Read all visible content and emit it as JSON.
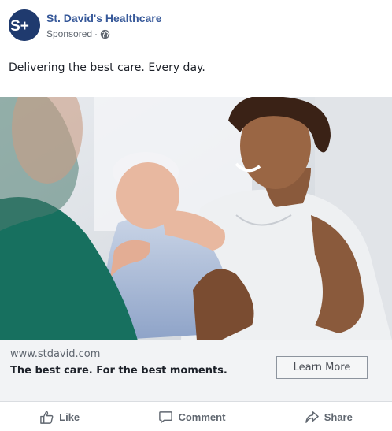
{
  "header": {
    "avatar_text": "S+",
    "page_name": "St. David's Healthcare",
    "sponsored": "Sponsored",
    "separator": "·",
    "privacy_icon": "globe-icon"
  },
  "post": {
    "text": "Delivering the best care. Every day."
  },
  "link": {
    "domain": "www.stdavid.com",
    "headline": "The best care. For the best moments.",
    "cta_label": "Learn More"
  },
  "actions": [
    {
      "label": "Like",
      "icon": "thumbs-up-icon"
    },
    {
      "label": "Comment",
      "icon": "comment-icon"
    },
    {
      "label": "Share",
      "icon": "share-icon"
    }
  ],
  "colors": {
    "brand_link": "#365899",
    "avatar_bg": "#1f3a6e",
    "scrub_green": "#17705f"
  }
}
